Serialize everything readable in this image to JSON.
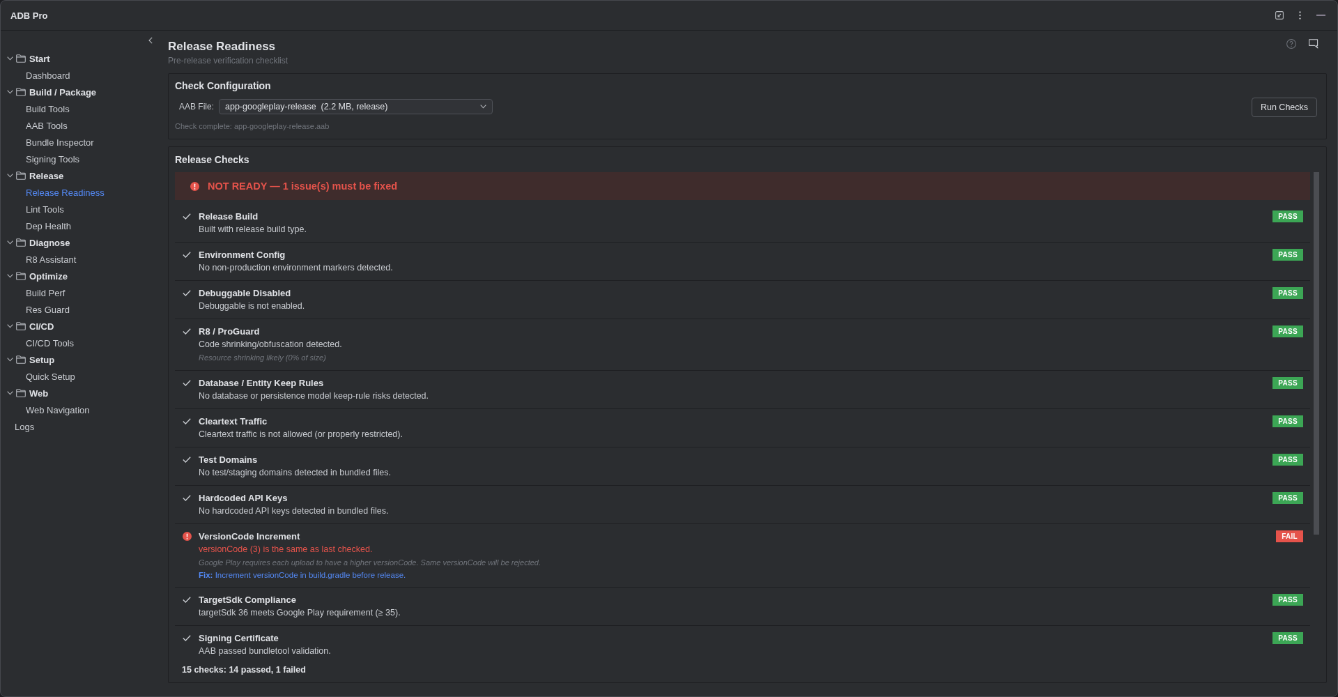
{
  "window": {
    "title": "ADB Pro"
  },
  "sidebar": {
    "items": [
      {
        "kind": "group",
        "label": "Start",
        "expanded": true,
        "children": [
          {
            "label": "Dashboard",
            "selected": false
          }
        ]
      },
      {
        "kind": "group",
        "label": "Build / Package",
        "expanded": true,
        "children": [
          {
            "label": "Build Tools",
            "selected": false
          },
          {
            "label": "AAB Tools",
            "selected": false
          },
          {
            "label": "Bundle Inspector",
            "selected": false
          },
          {
            "label": "Signing Tools",
            "selected": false
          }
        ]
      },
      {
        "kind": "group",
        "label": "Release",
        "expanded": true,
        "children": [
          {
            "label": "Release Readiness",
            "selected": true
          },
          {
            "label": "Lint Tools",
            "selected": false
          },
          {
            "label": "Dep Health",
            "selected": false
          }
        ]
      },
      {
        "kind": "group",
        "label": "Diagnose",
        "expanded": true,
        "children": [
          {
            "label": "R8 Assistant",
            "selected": false
          }
        ]
      },
      {
        "kind": "group",
        "label": "Optimize",
        "expanded": true,
        "children": [
          {
            "label": "Build Perf",
            "selected": false
          },
          {
            "label": "Res Guard",
            "selected": false
          }
        ]
      },
      {
        "kind": "group",
        "label": "CI/CD",
        "expanded": true,
        "children": [
          {
            "label": "CI/CD Tools",
            "selected": false
          }
        ]
      },
      {
        "kind": "group",
        "label": "Setup",
        "expanded": true,
        "children": [
          {
            "label": "Quick Setup",
            "selected": false
          }
        ]
      },
      {
        "kind": "group",
        "label": "Web",
        "expanded": true,
        "children": [
          {
            "label": "Web Navigation",
            "selected": false
          }
        ]
      },
      {
        "kind": "item",
        "label": "Logs",
        "selected": false
      }
    ]
  },
  "header": {
    "title": "Release Readiness",
    "subtitle": "Pre-release verification checklist"
  },
  "check_configuration": {
    "title": "Check Configuration",
    "aab_file": {
      "label": "AAB File:",
      "value": "app-googleplay-release  (2.2 MB, release)"
    },
    "status": "Check complete: app-googleplay-release.aab",
    "run_button": "Run Checks"
  },
  "release_checks": {
    "title": "Release Checks",
    "banner": {
      "kind": "error",
      "text": "NOT READY — 1 issue(s) must be fixed"
    },
    "rows": [
      {
        "kind": "pass",
        "title": "Release Build",
        "description": "Built with release build type.",
        "badge": "PASS"
      },
      {
        "kind": "pass",
        "title": "Environment Config",
        "description": "No non-production environment markers detected.",
        "badge": "PASS"
      },
      {
        "kind": "pass",
        "title": "Debuggable Disabled",
        "description": "Debuggable is not enabled.",
        "badge": "PASS"
      },
      {
        "kind": "pass",
        "title": "R8 / ProGuard",
        "description": "Code shrinking/obfuscation detected.",
        "note": "Resource shrinking likely (0% of size)",
        "badge": "PASS"
      },
      {
        "kind": "pass",
        "title": "Database / Entity Keep Rules",
        "description": "No database or persistence model keep-rule risks detected.",
        "badge": "PASS"
      },
      {
        "kind": "pass",
        "title": "Cleartext Traffic",
        "description": "Cleartext traffic is not allowed (or properly restricted).",
        "badge": "PASS"
      },
      {
        "kind": "pass",
        "title": "Test Domains",
        "description": "No test/staging domains detected in bundled files.",
        "badge": "PASS"
      },
      {
        "kind": "pass",
        "title": "Hardcoded API Keys",
        "description": "No hardcoded API keys detected in bundled files.",
        "badge": "PASS"
      },
      {
        "kind": "fail",
        "title": "VersionCode Increment",
        "description": "versionCode (3) is the same as last checked.",
        "note": "Google Play requires each upload to have a higher versionCode. Same versionCode will be rejected.",
        "fix": "**Fix:** Increment versionCode in build.gradle before release.",
        "badge": "FAIL"
      },
      {
        "kind": "pass",
        "title": "TargetSdk Compliance",
        "description": "targetSdk 36 meets Google Play requirement (≥ 35).",
        "badge": "PASS"
      },
      {
        "kind": "pass",
        "title": "Signing Certificate",
        "description": "AAB passed bundletool validation.",
        "badge": "PASS"
      }
    ],
    "summary": "15 checks: 14 passed, 1 failed"
  }
}
